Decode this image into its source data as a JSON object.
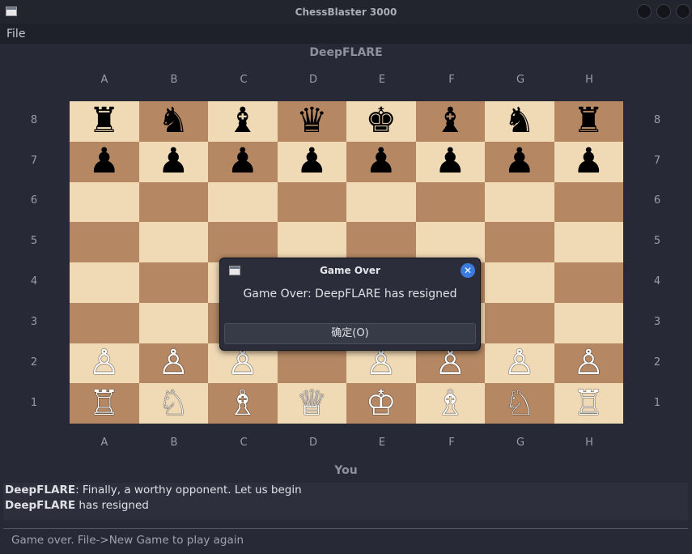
{
  "window": {
    "title": "ChessBlaster 3000"
  },
  "menu": {
    "file": "File"
  },
  "players": {
    "top": "DeepFLARE",
    "bottom": "You"
  },
  "files": [
    "A",
    "B",
    "C",
    "D",
    "E",
    "F",
    "G",
    "H"
  ],
  "ranks": [
    "8",
    "7",
    "6",
    "5",
    "4",
    "3",
    "2",
    "1"
  ],
  "board": [
    [
      "♜",
      "♞",
      "♝",
      "♛",
      "♚",
      "♝",
      "♞",
      "♜"
    ],
    [
      "♟",
      "♟",
      "♟",
      "♟",
      "♟",
      "♟",
      "♟",
      "♟"
    ],
    [
      "",
      "",
      "",
      "",
      "",
      "",
      "",
      ""
    ],
    [
      "",
      "",
      "",
      "",
      "",
      "",
      "",
      ""
    ],
    [
      "",
      "",
      "",
      "",
      "",
      "",
      "",
      ""
    ],
    [
      "",
      "",
      "",
      "",
      "",
      "",
      "",
      ""
    ],
    [
      "♙",
      "♙",
      "♙",
      "",
      "♙",
      "♙",
      "♙",
      "♙"
    ],
    [
      "♖",
      "♘",
      "♗",
      "♕",
      "♔",
      "♗",
      "♘",
      "♖"
    ]
  ],
  "dialog": {
    "title": "Game Over",
    "message": "Game Over: DeepFLARE has resigned",
    "ok_label": "确定(O)"
  },
  "chat": [
    {
      "sender": "DeepFLARE",
      "text": ": Finally, a worthy opponent. Let us begin"
    },
    {
      "sender": "DeepFLARE",
      "text": " has resigned"
    }
  ],
  "status": "Game over. File->New Game to play again",
  "colors": {
    "light_square": "#f0d9b5",
    "dark_square": "#b58863",
    "accent": "#3a7be0"
  }
}
